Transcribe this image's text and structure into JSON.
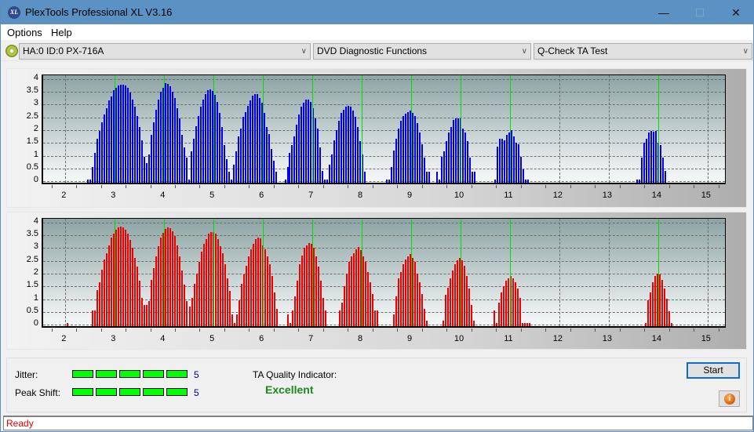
{
  "window": {
    "title": "PlexTools Professional XL V3.16",
    "logo_text": "XL",
    "minimize_glyph": "—",
    "maximize_glyph": "☐",
    "close_glyph": "✕"
  },
  "menu": {
    "items": [
      "Options",
      "Help"
    ]
  },
  "toolbar": {
    "drive": "HA:0 ID:0  PX-716A",
    "function": "DVD Diagnostic Functions",
    "test": "Q-Check TA Test",
    "dropdown_glyph": "∨"
  },
  "chart_data": [
    {
      "type": "bar",
      "name": "TA histogram (lands/top)",
      "color": "#0000ee",
      "xlim": [
        1.55,
        15.4
      ],
      "ylim": [
        -0.15,
        4.15
      ],
      "xticks": [
        "2",
        "3",
        "4",
        "5",
        "6",
        "7",
        "8",
        "9",
        "10",
        "11",
        "12",
        "13",
        "14",
        "15"
      ],
      "yticks": [
        "0",
        "0.5",
        "1",
        "1.5",
        "2",
        "2.5",
        "3",
        "3.5",
        "4"
      ],
      "reference_lines": [
        3,
        4,
        5,
        6,
        7,
        8,
        9,
        10,
        11,
        14
      ],
      "step": 0.0476,
      "segments": [
        {
          "start": 2.45,
          "values": [
            0,
            0,
            0.5,
            1.05,
            1.6,
            1.9,
            2.25,
            2.55,
            2.8,
            3.1,
            3.25,
            3.5,
            3.6,
            3.7,
            3.72,
            3.72,
            3.7,
            3.6,
            3.4,
            3.15,
            2.85,
            2.5,
            2.05,
            1.55,
            0.9,
            0.65,
            1.0,
            1.75,
            2.25,
            2.75,
            3.15,
            3.45,
            3.6,
            3.78,
            3.75,
            3.65,
            3.45,
            3.2,
            2.8,
            2.4,
            1.75,
            1.25,
            0.85
          ]
        },
        {
          "start": 4.46,
          "values": [
            0,
            0,
            1.1,
            1.6,
            2.1,
            2.5,
            2.85,
            3.15,
            3.35,
            3.5,
            3.55,
            3.48,
            3.32,
            3.05,
            2.6,
            2.05,
            1.35,
            0.8,
            0.3,
            0,
            0.6,
            1.1,
            1.7,
            2.0,
            2.45,
            2.65,
            2.9,
            3.1,
            3.3,
            3.35,
            3.35,
            3.2,
            3.0,
            2.6,
            2.05,
            1.8,
            1.2,
            0.75,
            0.3
          ]
        },
        {
          "start": 6.45,
          "values": [
            0,
            0.5,
            1.05,
            1.35,
            1.7,
            2.15,
            2.55,
            2.85,
            3.0,
            3.15,
            3.15,
            3.05,
            2.8,
            2.4,
            2.0,
            1.25,
            0.35,
            0,
            0,
            0.6,
            1.0,
            1.55,
            1.95,
            2.3,
            2.6,
            2.75,
            2.85,
            2.9,
            2.85,
            2.7,
            2.45,
            2.05,
            1.5,
            1.0,
            0.3
          ]
        },
        {
          "start": 8.5,
          "values": [
            0,
            0,
            0.5,
            1.15,
            1.6,
            2.0,
            2.3,
            2.5,
            2.58,
            2.65,
            2.7,
            2.62,
            2.5,
            2.2,
            1.85,
            1.4,
            0.85,
            0.3,
            0.3
          ]
        },
        {
          "start": 9.53,
          "values": [
            0.3,
            0,
            0.9,
            1.1,
            1.5,
            1.85,
            2.05,
            2.35,
            2.4,
            2.4,
            2.4,
            2.0,
            1.85,
            1.5,
            0.85,
            0.3,
            0.3
          ]
        },
        {
          "start": 10.7,
          "values": [
            0,
            1.3,
            1.6,
            1.6,
            1.55,
            1.75,
            1.85,
            1.95,
            1.7,
            1.45,
            1.4,
            0.9,
            0.4,
            0,
            0
          ]
        },
        {
          "start": 13.57,
          "values": [
            0,
            0,
            0.85,
            1.45,
            1.6,
            1.85,
            1.9,
            1.88,
            1.92,
            1.45,
            1.35,
            0.85,
            0.35
          ]
        }
      ]
    },
    {
      "type": "bar",
      "name": "TA histogram (pits/bottom)",
      "color": "#ee0000",
      "xlim": [
        1.55,
        15.4
      ],
      "ylim": [
        -0.15,
        4.15
      ],
      "xticks": [
        "2",
        "3",
        "4",
        "5",
        "6",
        "7",
        "8",
        "9",
        "10",
        "11",
        "12",
        "13",
        "14",
        "15"
      ],
      "yticks": [
        "0",
        "0.5",
        "1",
        "1.5",
        "2",
        "2.5",
        "3",
        "3.5",
        "4"
      ],
      "reference_lines": [
        3,
        4,
        5,
        6,
        7,
        8,
        9,
        10,
        11,
        14
      ],
      "step": 0.0476,
      "segments": [
        {
          "start": 2.05,
          "values": [
            0
          ]
        },
        {
          "start": 2.55,
          "values": [
            0.5,
            0.5,
            1.3,
            1.6,
            2.1,
            2.5,
            2.75,
            3.05,
            3.35,
            3.5,
            3.65,
            3.75,
            3.78,
            3.75,
            3.65,
            3.5,
            3.25,
            2.95,
            2.55,
            2.2,
            1.65,
            1.0,
            0.7,
            0.7,
            0.85,
            1.7,
            2.15,
            2.6,
            3.0,
            3.35,
            3.55,
            3.7,
            3.75,
            3.72,
            3.6,
            3.4,
            3.05,
            2.6,
            2.05,
            1.5,
            0.85
          ]
        },
        {
          "start": 4.52,
          "values": [
            0.65,
            1.0,
            1.55,
            1.95,
            2.4,
            2.8,
            3.1,
            3.3,
            3.5,
            3.58,
            3.58,
            3.5,
            3.3,
            3.0,
            2.75,
            2.3,
            1.75,
            1.25,
            0.35,
            0,
            0.35,
            0.9,
            1.55,
            1.9,
            2.25,
            2.6,
            2.9,
            3.1,
            3.3,
            3.35,
            3.32,
            3.05,
            2.9,
            2.6,
            2.3,
            1.85,
            1.2,
            0.55
          ]
        },
        {
          "start": 6.5,
          "values": [
            0.35,
            0,
            0.5,
            1.05,
            1.65,
            2.3,
            2.65,
            2.95,
            3.05,
            3.15,
            3.1,
            2.95,
            2.6,
            2.2,
            1.65,
            1.0,
            0.5
          ]
        },
        {
          "start": 7.55,
          "values": [
            0.5,
            0.8,
            1.45,
            1.95,
            2.4,
            2.6,
            2.75,
            2.88,
            2.98,
            2.85,
            2.6,
            2.4,
            2.0,
            1.6,
            1.15,
            0.5,
            0.5
          ]
        },
        {
          "start": 8.65,
          "values": [
            0.35,
            1.05,
            1.75,
            2.0,
            2.3,
            2.5,
            2.62,
            2.7,
            2.55,
            2.4,
            1.95,
            1.6,
            1.15,
            0.55,
            0.1
          ]
        },
        {
          "start": 9.65,
          "values": [
            0.1,
            1.1,
            1.4,
            1.75,
            2.05,
            2.3,
            2.45,
            2.55,
            2.45,
            2.25,
            1.85,
            1.35,
            0.7,
            0.1
          ]
        },
        {
          "start": 10.68,
          "values": [
            0.5,
            0,
            0.8,
            1.2,
            1.45,
            1.65,
            1.75,
            1.85,
            1.75,
            1.6,
            1.35,
            1.0,
            0,
            0,
            0,
            0
          ]
        },
        {
          "start": 13.75,
          "values": [
            0,
            0.9,
            1.2,
            1.6,
            1.85,
            1.95,
            1.9,
            1.7,
            1.35,
            0.95,
            0.45,
            0
          ]
        }
      ]
    }
  ],
  "metrics": {
    "jitter_label": "Jitter:",
    "jitter_value": "5",
    "jitter_level": 5,
    "peak_shift_label": "Peak Shift:",
    "peak_shift_value": "5",
    "peak_shift_level": 5,
    "max_level": 5,
    "ta_quality_label": "TA Quality Indicator:",
    "ta_quality_value": "Excellent"
  },
  "buttons": {
    "start": "Start",
    "info_glyph": "i"
  },
  "status": {
    "text": "Ready"
  }
}
